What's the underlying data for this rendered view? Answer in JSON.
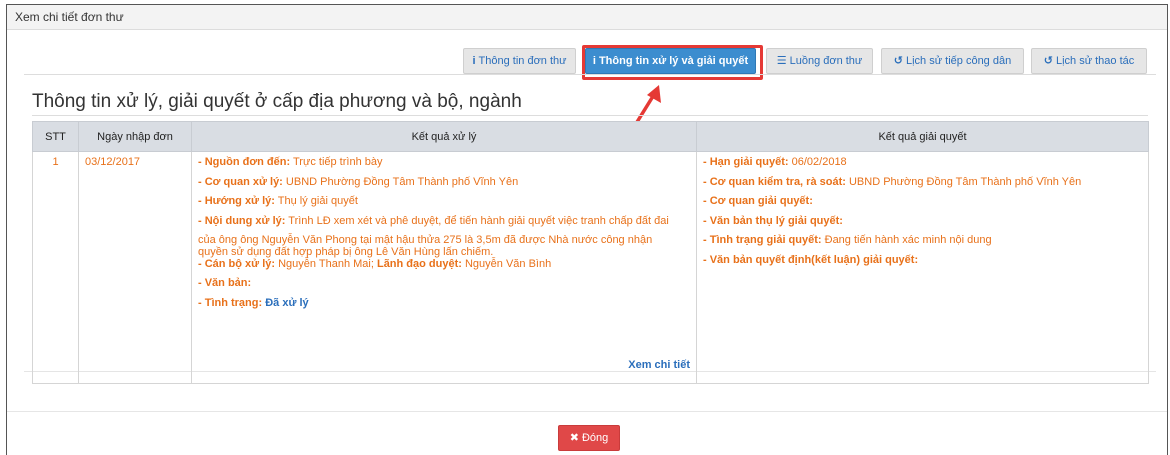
{
  "dialog": {
    "title": "Xem chi tiết đơn thư"
  },
  "tabs": [
    {
      "label": "Thông tin đơn thư",
      "icon": "info-icon",
      "glyph": "i"
    },
    {
      "label": "Thông tin xử lý và giải quyết",
      "icon": "info-icon",
      "glyph": "i",
      "active": true
    },
    {
      "label": "Luồng đơn thư",
      "icon": "list-icon",
      "glyph": "☰"
    },
    {
      "label": "Lịch sử tiếp công dân",
      "icon": "history-icon",
      "glyph": "↺"
    },
    {
      "label": "Lịch sử thao tác",
      "icon": "history-icon",
      "glyph": "↺"
    }
  ],
  "section": {
    "title": "Thông tin xử lý, giải quyết ở cấp địa phương và bộ, ngành"
  },
  "table": {
    "headers": [
      "STT",
      "Ngày nhập đơn",
      "Kết quả xử lý",
      "Kết quả giải quyết"
    ],
    "row": {
      "stt": "1",
      "date": "03/12/2017",
      "xuly": {
        "nguon_label": "- Nguồn đơn đến:",
        "nguon_value": "Trực tiếp trình bày",
        "coquan_label": "- Cơ quan xử lý:",
        "coquan_value": "UBND Phường Đồng Tâm Thành phố Vĩnh Yên",
        "huong_label": "- Hướng xử lý:",
        "huong_value": "Thụ lý giải quyết",
        "noidung_label": "- Nội dung xử lý:",
        "noidung_value": "Trình LĐ xem xét và phê duyệt, để tiến hành giải quyết việc tranh chấp đất đai",
        "noidung_line2": "của ông ông Nguyễn Văn Phong tại mật hậu thửa 275 là 3,5m đã được Nhà nước công nhận",
        "noidung_line3": "quyền sử dụng đất hợp pháp bị ông Lê Văn Hùng lấn chiếm.",
        "canbo_label": "- Cán bộ xử lý:",
        "canbo_value": "Nguyễn Thanh Mai;",
        "lanhdao_label": "Lãnh đạo duyệt:",
        "lanhdao_value": "Nguyễn Văn Bình",
        "vanban_label": "- Văn bản:",
        "tinhtrang_label": "- Tình trạng:",
        "tinhtrang_value": "Đã xử lý",
        "detail_link": "Xem chi tiết"
      },
      "giaiquyet": {
        "han_label": "- Hạn giải quyết:",
        "han_value": "06/02/2018",
        "kiemtra_label": "- Cơ quan kiểm tra, rà soát:",
        "kiemtra_value": "UBND Phường Đồng Tâm Thành phố Vĩnh Yên",
        "coquan_label": "- Cơ quan giải quyết:",
        "vanban_label": "- Văn bản thụ lý giải quyết:",
        "tinhtrang_label": "- Tình trạng giải quyết:",
        "tinhtrang_value": "Đang tiến hành xác minh nội dung",
        "quyetdinh_label": "- Văn bản quyết định(kết luận) giải quyết:"
      }
    }
  },
  "footer": {
    "close_label": "Đóng",
    "close_icon": "close-icon"
  },
  "colors": {
    "accent": "#3c8dcf",
    "orange": "#e8711a",
    "danger": "#e04848",
    "highlight": "#e53935"
  }
}
